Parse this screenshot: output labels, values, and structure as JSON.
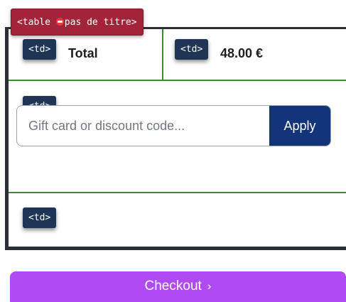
{
  "table": {
    "tag_prefix": "<table ",
    "tag_suffix": "pas de titre>",
    "tag_icon": "no-entry-icon",
    "td_label": "<td>",
    "total_label": "Total",
    "total_value": "48.00 €"
  },
  "discount": {
    "placeholder": "Gift card or discount code...",
    "value": "",
    "apply_label": "Apply"
  },
  "checkout": {
    "label": "Checkout",
    "chevron": "›"
  },
  "colors": {
    "accent_purple": "#b04bf3",
    "apply_blue": "#143479",
    "td_badge_bg": "#1f3556",
    "table_tag_bg": "#a3243a",
    "row_border_green": "#3c8a2e"
  }
}
